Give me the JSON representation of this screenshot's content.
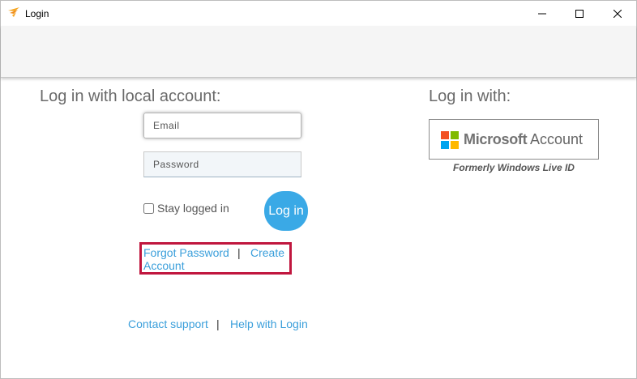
{
  "window": {
    "title": "Login",
    "controls": {
      "minimize_icon": "minimize-icon",
      "maximize_icon": "maximize-icon",
      "close_icon": "close-icon"
    }
  },
  "local_login": {
    "heading": "Log in with local account:",
    "email_placeholder": "Email",
    "password_placeholder": "Password",
    "stay_logged_in_label": "Stay logged in",
    "login_button_label": "Log in",
    "forgot_password_label": "Forgot Password",
    "separator": "|",
    "create_account_label_line1": "Create",
    "create_account_label_line2": "Account"
  },
  "footer_links": {
    "contact_support_label": "Contact support",
    "separator": "|",
    "help_with_login_label": "Help with Login"
  },
  "external_login": {
    "heading": "Log in with:",
    "microsoft_label": "Microsoft",
    "account_label": "Account",
    "formerly_note": "Formerly Windows Live ID"
  },
  "colors": {
    "link": "#3b9fdb",
    "login_button": "#3aa9e6",
    "highlight_border": "#c0163e",
    "ms_red": "#f25022",
    "ms_green": "#7fba00",
    "ms_blue": "#00a4ef",
    "ms_yellow": "#ffb900"
  }
}
